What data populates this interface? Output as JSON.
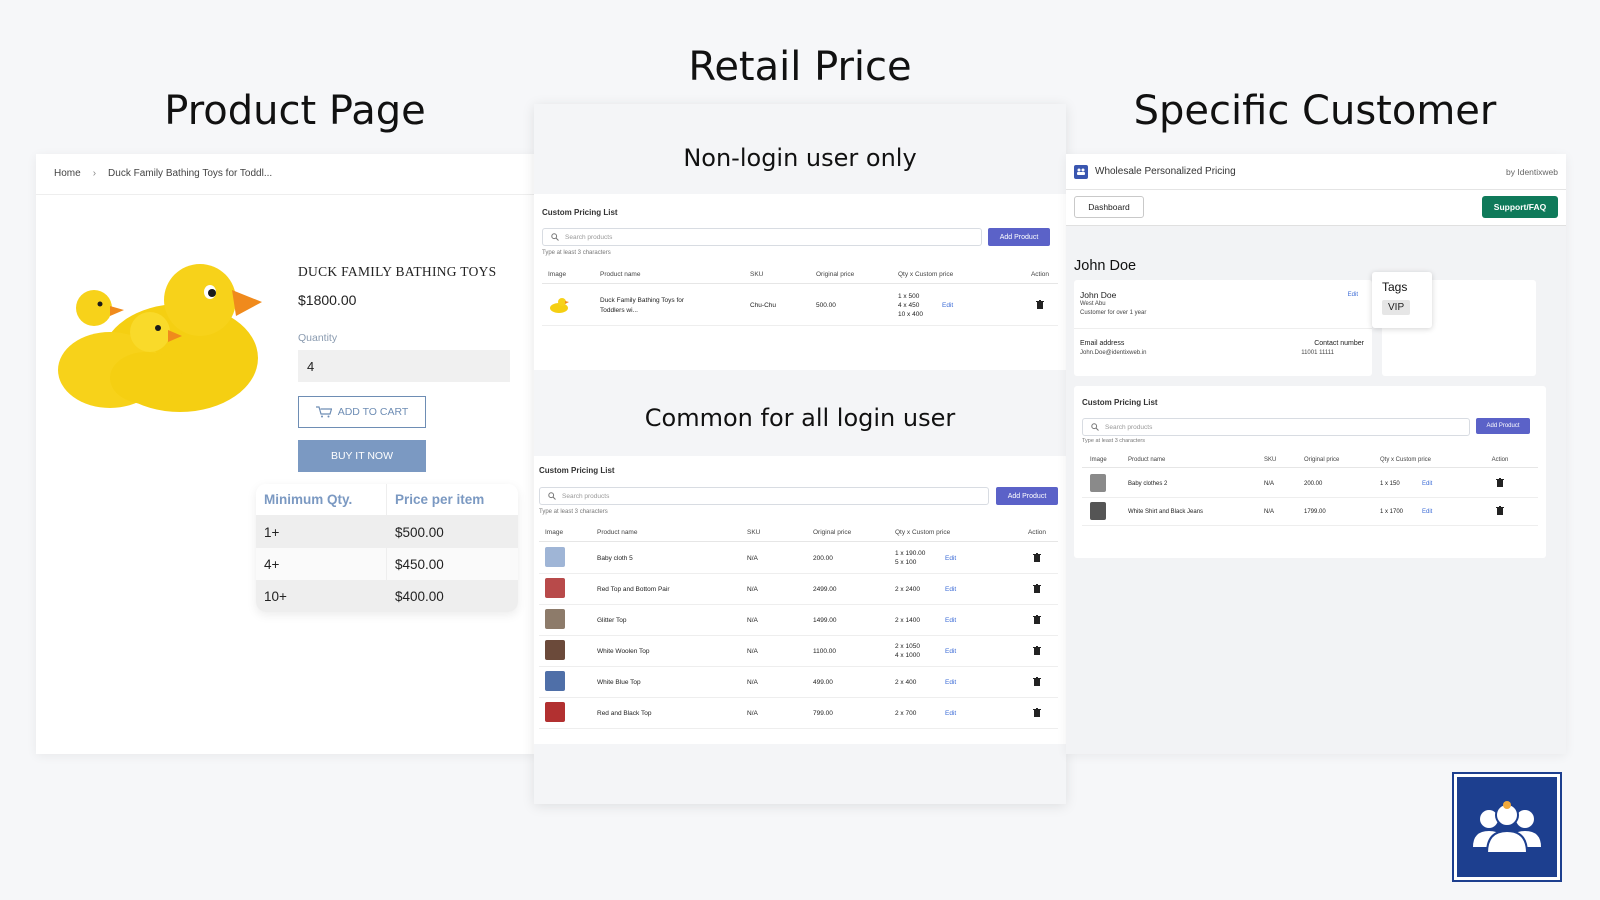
{
  "headings": {
    "product_page": "Product Page",
    "retail_price": "Retail Price",
    "specific_customer": "Specific Customer"
  },
  "product_page": {
    "breadcrumb_home": "Home",
    "breadcrumb_sep": "›",
    "breadcrumb_current": "Duck Family Bathing Toys for Toddl...",
    "title": "DUCK FAMILY BATHING TOYS",
    "price": "$1800.00",
    "quantity_label": "Quantity",
    "quantity_value": "4",
    "add_to_cart": "ADD TO CART",
    "buy_now": "BUY IT NOW",
    "tier_headers": [
      "Minimum Qty.",
      "Price per item"
    ],
    "tiers": [
      {
        "qty": "1+",
        "price": "$500.00"
      },
      {
        "qty": "4+",
        "price": "$450.00"
      },
      {
        "qty": "10+",
        "price": "$400.00"
      }
    ]
  },
  "retail": {
    "nonlogin_heading": "Non-login user only",
    "common_heading": "Common for all login user",
    "card_title": "Custom Pricing List",
    "search_placeholder": "Search products",
    "hint": "Type at least 3 characters",
    "add_product": "Add Product",
    "columns": [
      "Image",
      "Product name",
      "SKU",
      "Original price",
      "Qty x Custom price",
      "Action"
    ],
    "edit": "Edit",
    "nonlogin_row": {
      "name_line1": "Duck Family Bathing Toys for",
      "name_line2": "Toddlers wi...",
      "sku": "Chu-Chu",
      "orig": "500.00",
      "qty": [
        "1 x 500",
        "4 x 450",
        "10 x 400"
      ]
    },
    "common_rows": [
      {
        "name": "Baby cloth 5",
        "sku": "N/A",
        "orig": "200.00",
        "qty": [
          "1 x 190.00",
          "5 x 100"
        ],
        "color": "#9fb5d6"
      },
      {
        "name": "Red Top and Bottom Pair",
        "sku": "N/A",
        "orig": "2499.00",
        "qty": [
          "2 x 2400"
        ],
        "color": "#b84a4a"
      },
      {
        "name": "Glitter Top",
        "sku": "N/A",
        "orig": "1499.00",
        "qty": [
          "2 x 1400"
        ],
        "color": "#8d7b6a"
      },
      {
        "name": "White Woolen Top",
        "sku": "N/A",
        "orig": "1100.00",
        "qty": [
          "2 x 1050",
          "4 x 1000"
        ],
        "color": "#6b4a3a"
      },
      {
        "name": "White Blue Top",
        "sku": "N/A",
        "orig": "499.00",
        "qty": [
          "2 x 400"
        ],
        "color": "#4f6fa8"
      },
      {
        "name": "Red and Black Top",
        "sku": "N/A",
        "orig": "799.00",
        "qty": [
          "2 x 700"
        ],
        "color": "#b23030"
      }
    ]
  },
  "customer": {
    "app_name": "Wholesale Personalized Pricing",
    "by": "by Identixweb",
    "dashboard": "Dashboard",
    "support": "Support/FAQ",
    "name": "John Doe",
    "card_name": "John Doe",
    "location": "West Abu",
    "since": "Customer for over 1 year",
    "edit": "Edit",
    "email_label": "Email address",
    "email_value": "John.Doe@identixweb.in",
    "phone_label": "Contact number",
    "phone_value": "11001 11111",
    "tags_label": "Tags",
    "tag": "VIP",
    "card_title": "Custom Pricing List",
    "search_placeholder": "Search products",
    "hint": "Type at least 3 characters",
    "add_product": "Add Product",
    "columns": [
      "Image",
      "Product name",
      "SKU",
      "Original price",
      "Qty x Custom price",
      "Action"
    ],
    "rows": [
      {
        "name": "Baby clothes 2",
        "sku": "N/A",
        "orig": "200.00",
        "qty": "1 x 150",
        "color": "#8a8a8a"
      },
      {
        "name": "White Shirt and Black Jeans",
        "sku": "N/A",
        "orig": "1799.00",
        "qty": "1 x 1700",
        "color": "#555555"
      }
    ]
  },
  "colors": {
    "accent_blue": "#5b62c8",
    "support_green": "#0f7a5a",
    "product_blue": "#7b99c2",
    "duck_yellow": "#f7d21a"
  }
}
